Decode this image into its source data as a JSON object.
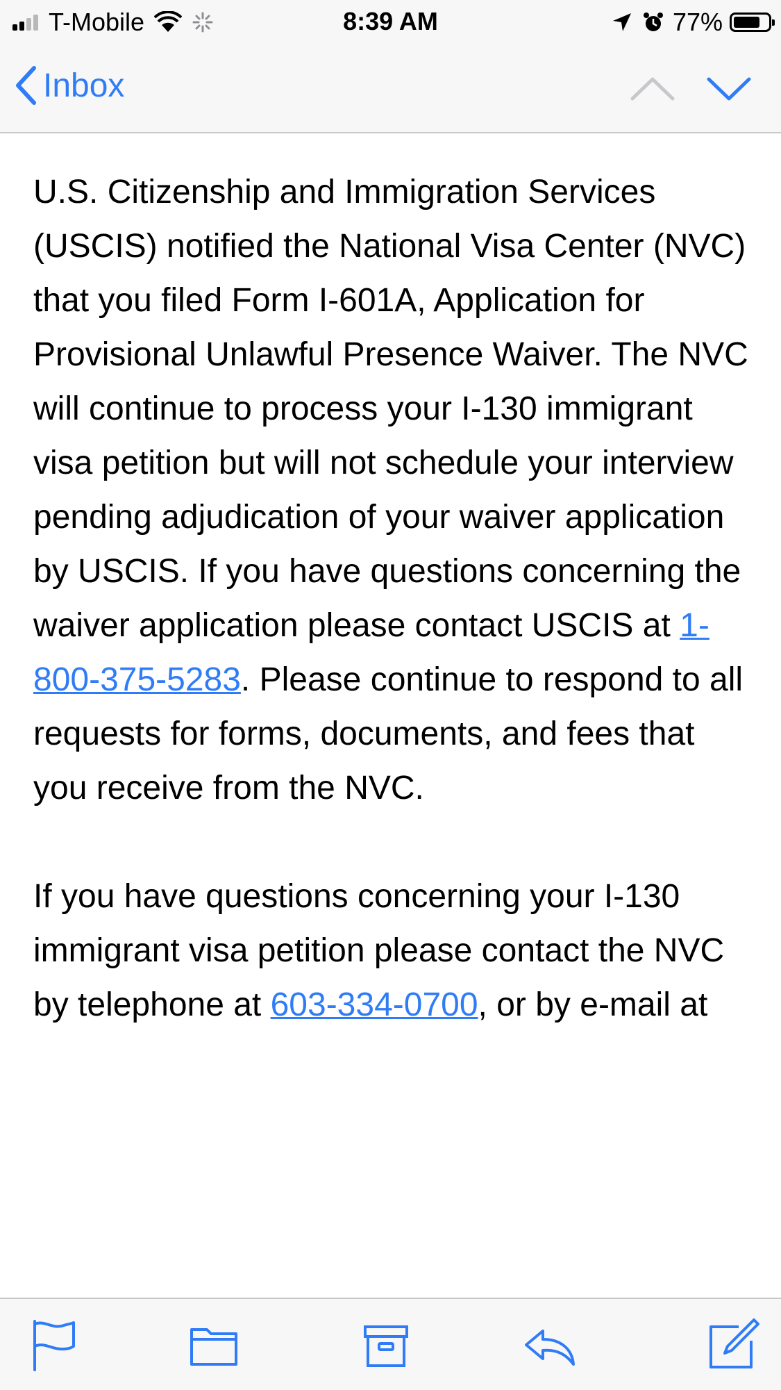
{
  "status_bar": {
    "carrier": "T-Mobile",
    "time": "8:39 AM",
    "battery_percent": "77%",
    "battery_level": 0.77,
    "icons": [
      "signal-icon",
      "wifi-icon",
      "activity-spinner-icon",
      "location-arrow-icon",
      "alarm-icon",
      "battery-icon"
    ]
  },
  "navbar": {
    "back_label": "Inbox",
    "icons": [
      "chevron-left-icon",
      "chevron-up-icon",
      "chevron-down-icon"
    ],
    "previous_message_enabled": false,
    "next_message_enabled": true
  },
  "email": {
    "para1_text_a": "U.S. Citizenship and Immigration Services (USCIS) notified the National Visa Center (NVC) that you filed Form I-601A, Application for Provisional Unlawful Presence Waiver. The NVC will continue to process your I-130 immigrant visa petition but will not schedule your interview pending adjudication of your waiver application by USCIS. If you have questions concerning the waiver application please contact USCIS at ",
    "uscis_phone": "1-800-375-5283",
    "para1_text_b": ". Please continue to respond to all requests for forms, documents, and fees that you receive from the NVC.",
    "para2_text_a": "If you have questions concerning your I-130 immigrant visa petition please contact the NVC by telephone at ",
    "nvc_phone": "603-334-0700",
    "para2_text_b": ", or by e-mail at"
  },
  "toolbar": {
    "icons": [
      "flag-icon",
      "folder-icon",
      "archive-icon",
      "reply-icon",
      "compose-icon"
    ]
  },
  "colors": {
    "accent": "#2f7cf6",
    "bar_background": "#f7f7f7",
    "separator": "#c8c7cc",
    "disabled": "#c7c7cc"
  }
}
